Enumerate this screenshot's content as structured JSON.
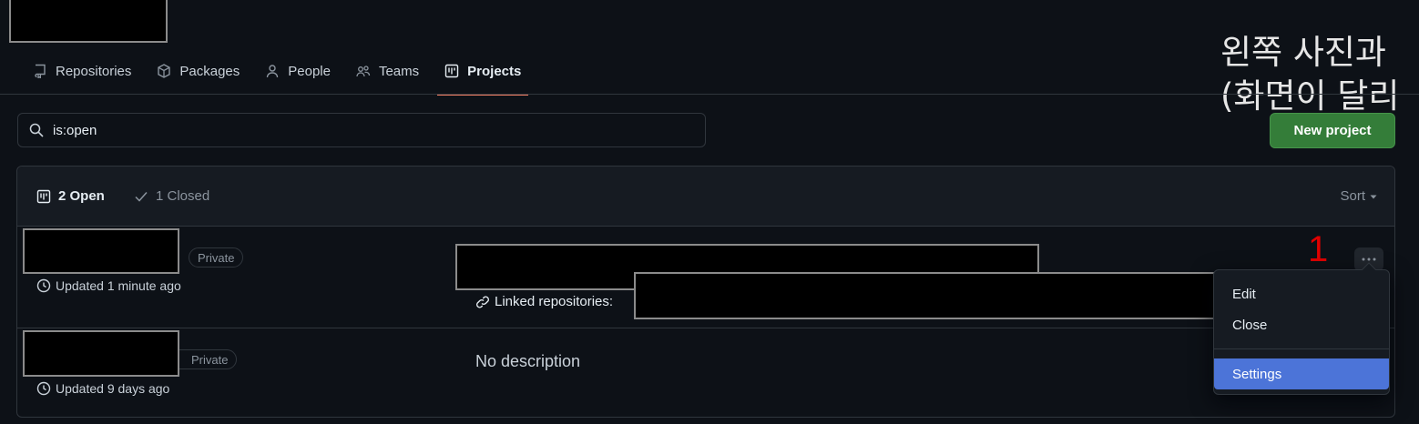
{
  "overlay_text": {
    "line1": "왼쪽 사진과",
    "line2": "(화면이 달리"
  },
  "nav": {
    "items": [
      {
        "label": "Repositories",
        "icon": "repo-icon"
      },
      {
        "label": "Packages",
        "icon": "package-icon"
      },
      {
        "label": "People",
        "icon": "person-icon"
      },
      {
        "label": "Teams",
        "icon": "people-icon"
      },
      {
        "label": "Projects",
        "icon": "project-icon",
        "active": true
      }
    ]
  },
  "search": {
    "value": "is:open"
  },
  "new_project_label": "New project",
  "list": {
    "open_label": "2 Open",
    "closed_label": "1 Closed",
    "sort_label": "Sort"
  },
  "projects": [
    {
      "visibility": "Private",
      "updated": "Updated 1 minute ago",
      "linked_label": "Linked repositories:"
    },
    {
      "visibility": "Private",
      "updated": "Updated 9 days ago",
      "description": "No description"
    }
  ],
  "annotation_number": "1",
  "menu": {
    "items": [
      "Edit",
      "Close",
      "Settings"
    ]
  },
  "colors": {
    "accent_underline": "#f78166",
    "primary_button": "#347d39",
    "menu_selected": "#4c74d8",
    "annotation_red": "#e00000"
  }
}
